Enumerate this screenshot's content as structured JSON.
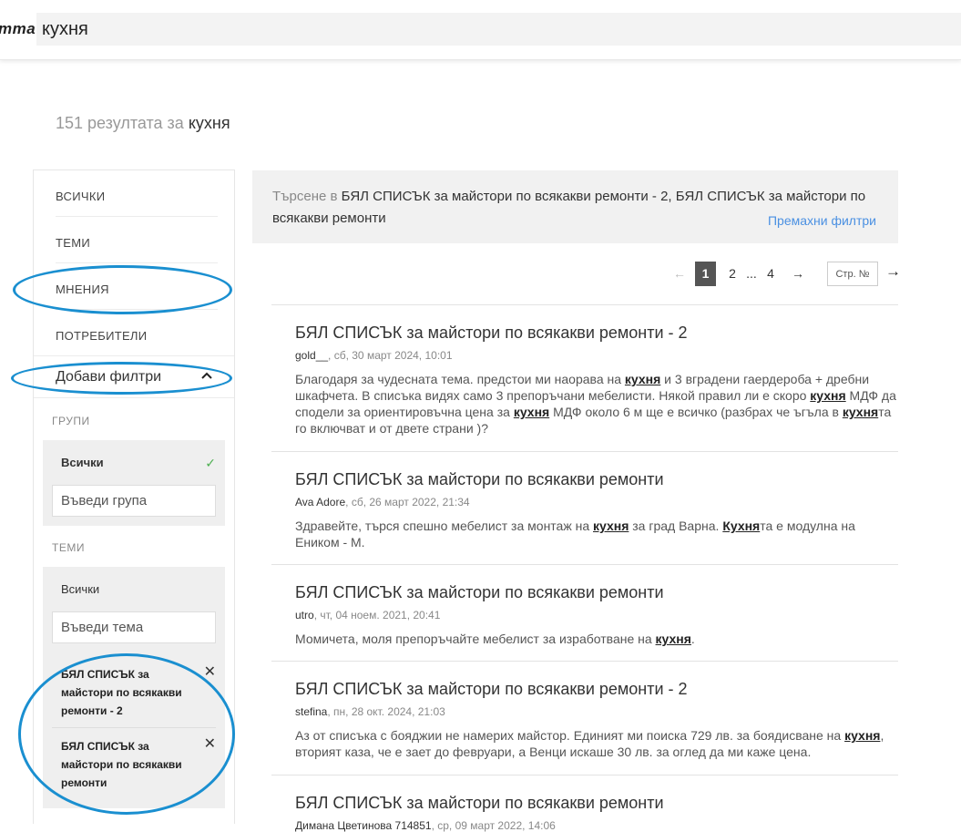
{
  "header": {
    "logo": "mma",
    "search_value": "кухня"
  },
  "results_count": {
    "prefix": "151 резултата за",
    "query": "кухня"
  },
  "sidebar": {
    "nav": [
      "ВСИЧКИ",
      "ТЕМИ",
      "МНЕНИЯ",
      "ПОТРЕБИТЕЛИ"
    ],
    "add_filters": "Добави филтри",
    "groups_title": "ГРУПИ",
    "groups_all": "Всички",
    "groups_placeholder": "Въведи група",
    "topics_title": "ТЕМИ",
    "topics_all": "Всички",
    "topics_placeholder": "Въведи тема",
    "selected_topics": [
      "БЯЛ СПИСЪК за майстори по всякакви ремонти - 2",
      "БЯЛ СПИСЪК за майстори по всякакви ремонти"
    ]
  },
  "banner": {
    "lead": "Търсене в",
    "text": "БЯЛ СПИСЪК за майстори по всякакви ремонти - 2, БЯЛ СПИСЪК за майстори по всякакви ремонти",
    "remove_filters": "Премахни филтри"
  },
  "pagination": {
    "prev": "←",
    "pages": [
      "1",
      "2",
      "...",
      "4"
    ],
    "current": "1",
    "next": "→",
    "page_input_placeholder": "Стр. №",
    "go": "→"
  },
  "results": [
    {
      "title": "БЯЛ СПИСЪК за майстори по всякакви ремонти - 2",
      "author": "gold__",
      "date": ", сб, 30 март 2024, 10:01",
      "snippet": "Благодаря за чудесната тема. предстои ми наорава на **кухня** и 3 вградени гаердероба + дребни шкафчета. В списъка видях само 3 препоръчани мебелисти. Някой правил ли е скоро **кухня** МДФ да сподели за ориентировъчна цена за **кухня** МДФ около 6 м ще е всичко (разбрах че ъгъла в **кухня**та го включват и от двете страни )?"
    },
    {
      "title": "БЯЛ СПИСЪК за майстори по всякакви ремонти",
      "author": "Ava Adore",
      "date": ", сб, 26 март 2022, 21:34",
      "snippet": "Здравейте, търся спешно мебелист за монтаж на **кухня** за град Варна. **Кухня**та е модулна на Еником - М."
    },
    {
      "title": "БЯЛ СПИСЪК за майстори по всякакви ремонти",
      "author": "utro",
      "date": ", чт, 04 ноем. 2021, 20:41",
      "snippet": "Момичета, моля препоръчайте мебелист за изработване на **кухня**."
    },
    {
      "title": "БЯЛ СПИСЪК за майстори по всякакви ремонти - 2",
      "author": "stefina",
      "date": ", пн, 28 окт. 2024, 21:03",
      "snippet": "Аз от списъка с бояджии не намерих майстор. Единият ми поиска 729 лв. за боядисване на **кухня**, вторият каза, че е зает до февруари, а Венци искаше 30 лв. за оглед да ми каже цена."
    },
    {
      "title": "БЯЛ СПИСЪК за майстори по всякакви ремонти",
      "author": "Димана Цветинова 714851",
      "date": ", ср, 09 март 2022, 14:06",
      "snippet": ""
    }
  ],
  "colors": {
    "annotation": "#1a8fd0",
    "link": "#4a90e2",
    "check": "#4caf50",
    "active_page": "#555555"
  }
}
